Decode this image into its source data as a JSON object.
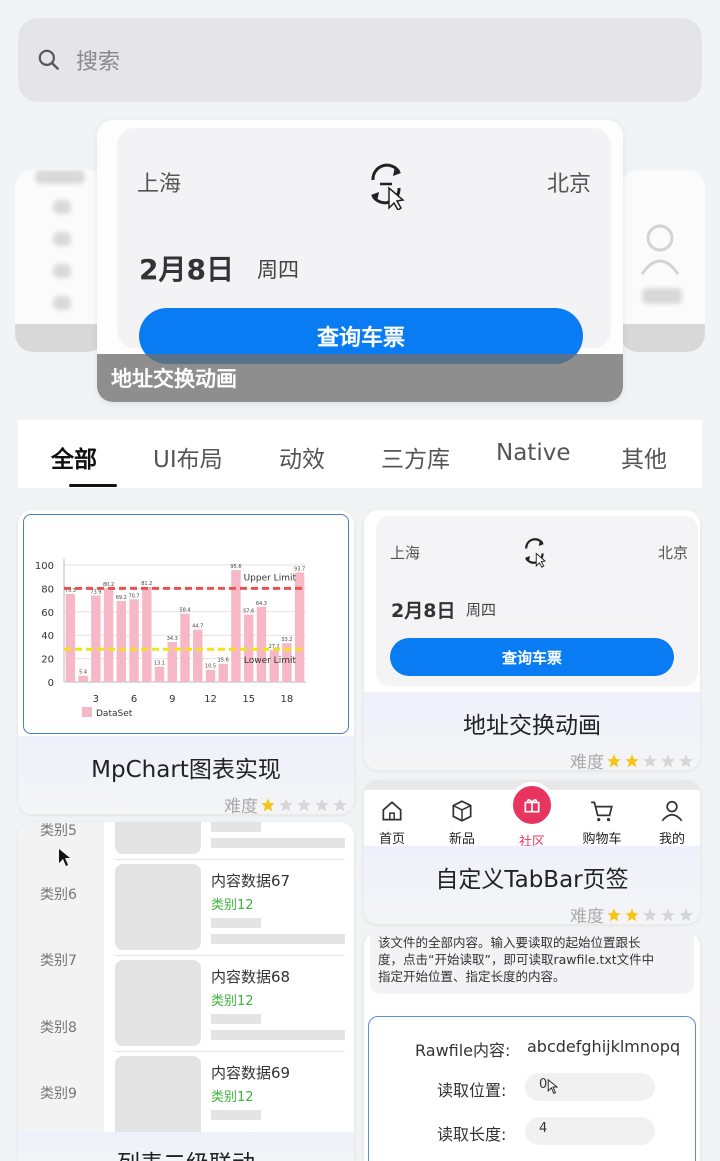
{
  "search": {
    "placeholder": "搜索"
  },
  "banner": {
    "from_city": "上海",
    "to_city": "北京",
    "date": "2月8日",
    "weekday": "周四",
    "button": "查询车票",
    "caption": "地址交换动画"
  },
  "tabs": [
    "全部",
    "UI布局",
    "动效",
    "三方库",
    "Native",
    "其他"
  ],
  "rating_label": "难度",
  "colors": {
    "accent": "#0a7cf3",
    "star_on": "#f5c518",
    "star_off": "#d6d6d6",
    "chart_bar": "#f6b8c6",
    "upper_limit": "#e05555",
    "lower_limit": "#f2e21c"
  },
  "cards": {
    "chart": {
      "title": "MpChart图表实现",
      "stars": 1
    },
    "ticket": {
      "from_city": "上海",
      "to_city": "北京",
      "date": "2月8日",
      "weekday": "周四",
      "button": "查询车票",
      "title": "地址交换动画",
      "stars": 2
    },
    "tabbar": {
      "items": [
        "首页",
        "新品",
        "社区",
        "购物车",
        "我的"
      ],
      "title": "自定义TabBar页签",
      "stars": 2
    },
    "list": {
      "categories": [
        "类别5",
        "类别6",
        "类别7",
        "类别8",
        "类别9"
      ],
      "items": [
        {
          "title": "内容数据67",
          "sub": "类别12"
        },
        {
          "title": "内容数据68",
          "sub": "类别12"
        },
        {
          "title": "内容数据69",
          "sub": "类别12"
        }
      ],
      "title": "列表二级联动"
    },
    "rawfile": {
      "description_1": "该文件的全部内容。输入要读取的起始位置跟长",
      "description_2": "度，点击“开始读取”，即可读取rawfile.txt文件中",
      "description_3": "指定开始位置、指定长度的内容。",
      "content_label": "Rawfile内容:",
      "content_value": "abcdefghijklmnopq",
      "position_label": "读取位置:",
      "position_value": "0",
      "length_label": "读取长度:",
      "length_value": "4"
    }
  },
  "chart_data": {
    "type": "bar",
    "x": [
      1,
      2,
      3,
      4,
      5,
      6,
      7,
      8,
      9,
      10,
      11,
      12,
      13,
      14,
      15,
      16,
      17,
      18,
      19
    ],
    "values": [
      75.3,
      5.4,
      73.9,
      80.2,
      69.2,
      70.7,
      81.2,
      13.1,
      34.3,
      58.4,
      44.7,
      10.5,
      15.6,
      95.6,
      57.6,
      64.3,
      27.2,
      33.2,
      93.7
    ],
    "xticks": [
      3,
      6,
      9,
      12,
      15,
      18
    ],
    "yticks": [
      0,
      20,
      40,
      60,
      80,
      100
    ],
    "ylim": [
      0,
      100
    ],
    "limit_lines": [
      {
        "label": "Upper Limit",
        "value": 80
      },
      {
        "label": "Lower Limit",
        "value": 28
      }
    ],
    "legend": "DataSet"
  }
}
